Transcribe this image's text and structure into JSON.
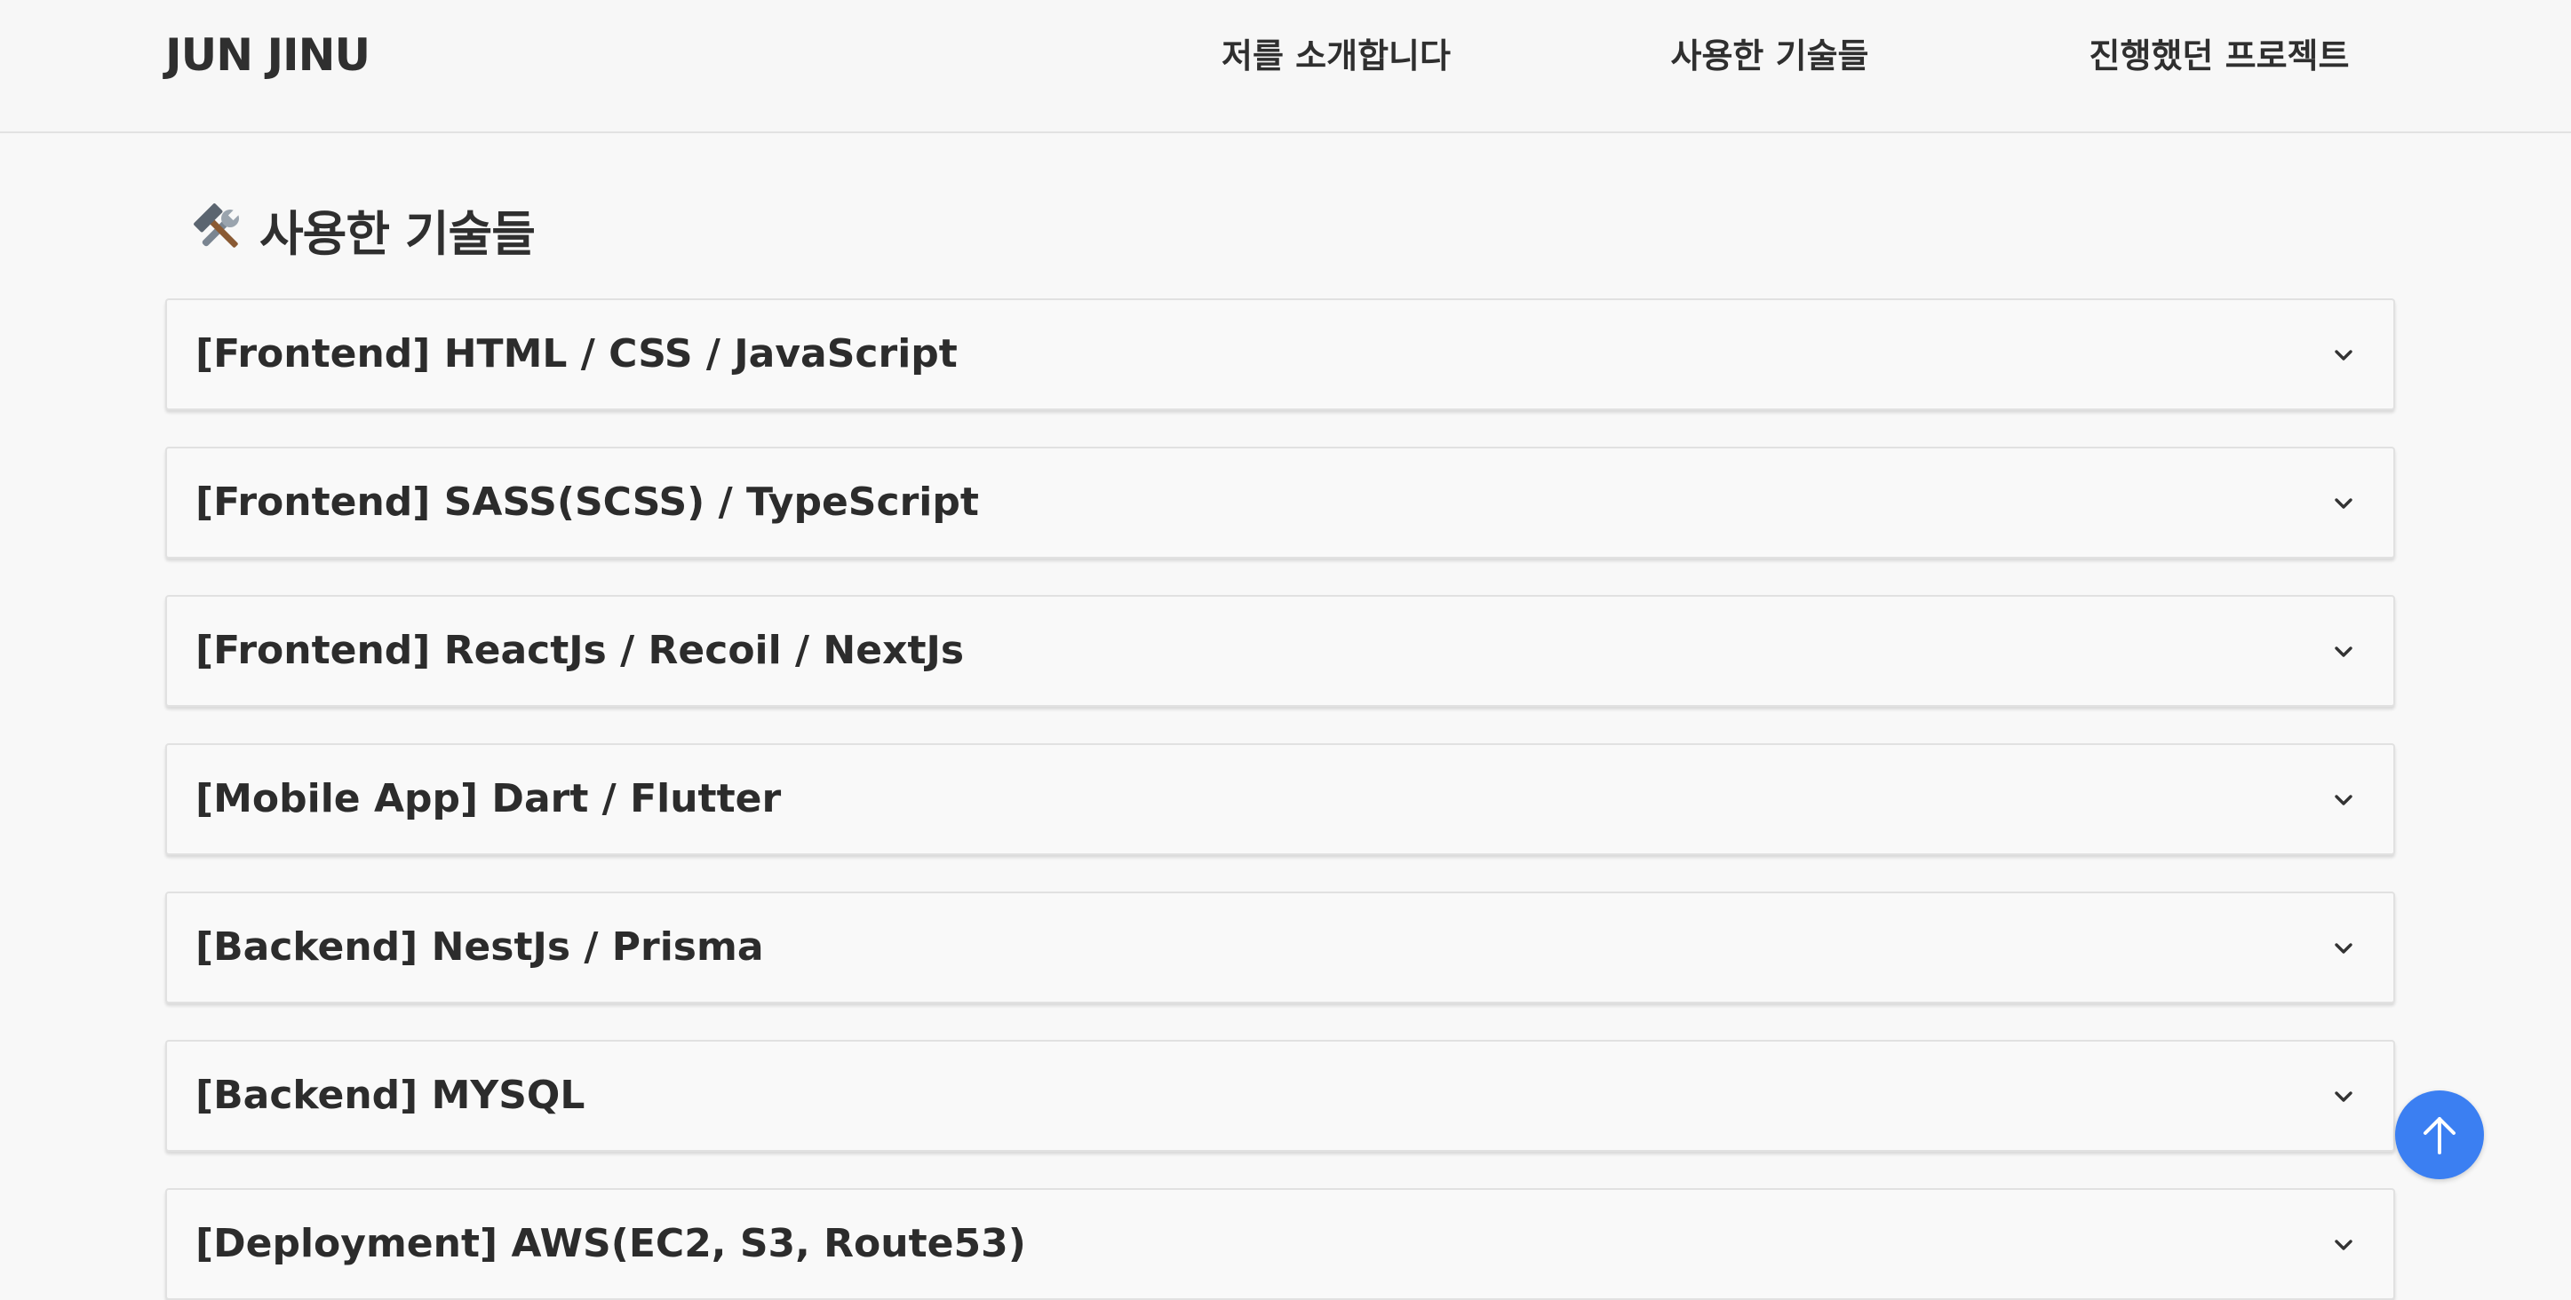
{
  "header": {
    "logo": "JUN JINU",
    "nav": [
      {
        "label": "저를 소개합니다"
      },
      {
        "label": "사용한 기술들"
      },
      {
        "label": "진행했던 프로젝트"
      }
    ]
  },
  "section": {
    "icon": "hammer-and-wrench-icon",
    "title": "사용한 기술들"
  },
  "accordions": [
    {
      "label": "[Frontend] HTML / CSS / JavaScript"
    },
    {
      "label": "[Frontend] SASS(SCSS) / TypeScript"
    },
    {
      "label": "[Frontend] ReactJs / Recoil / NextJs"
    },
    {
      "label": "[Mobile App] Dart / Flutter"
    },
    {
      "label": "[Backend] NestJs / Prisma"
    },
    {
      "label": "[Backend] MYSQL"
    },
    {
      "label": "[Deployment] AWS(EC2, S3, Route53)"
    }
  ],
  "scroll_top": {
    "icon": "arrow-up-icon",
    "color": "#3b7ff2"
  }
}
